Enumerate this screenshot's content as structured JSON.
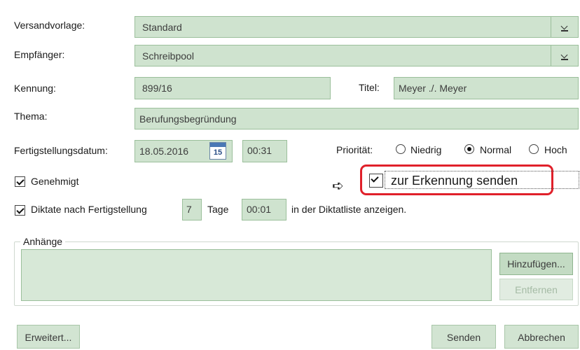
{
  "form": {
    "versand": {
      "label": "Versandvorlage:",
      "value": "Standard"
    },
    "empfaenger": {
      "label": "Empfänger:",
      "value": "Schreibpool"
    },
    "kennung": {
      "label": "Kennung:",
      "value": "899/16"
    },
    "titel": {
      "label": "Titel:",
      "value": "Meyer ./. Meyer"
    },
    "thema": {
      "label": "Thema:",
      "value": "Berufungsbegründung"
    },
    "fertigstellung": {
      "label": "Fertigstellungsdatum:",
      "date": "18.05.2016",
      "calendar_day": "15",
      "time": "00:31"
    },
    "prioritaet": {
      "label": "Priorität:",
      "options": [
        "Niedrig",
        "Normal",
        "Hoch"
      ],
      "selected": "Normal"
    },
    "genehmigt": {
      "label": "Genehmigt",
      "checked": true
    },
    "erkennung": {
      "label": "zur Erkennung senden",
      "checked": true
    },
    "diktate": {
      "label_prefix": "Diktate nach Fertigstellung",
      "days": "7",
      "days_label": "Tage",
      "time": "00:01",
      "label_suffix": "in der Diktatliste anzeigen.",
      "checked": true
    }
  },
  "anhaenge": {
    "legend": "Anhänge",
    "add_button": "Hinzufügen...",
    "remove_button": "Entfernen"
  },
  "footer": {
    "advanced_button": "Erweitert...",
    "send_button": "Senden",
    "cancel_button": "Abbrechen"
  },
  "colors": {
    "field_bg": "#cfe3cf",
    "field_border": "#9bbf9b",
    "highlight": "#e0202a"
  }
}
